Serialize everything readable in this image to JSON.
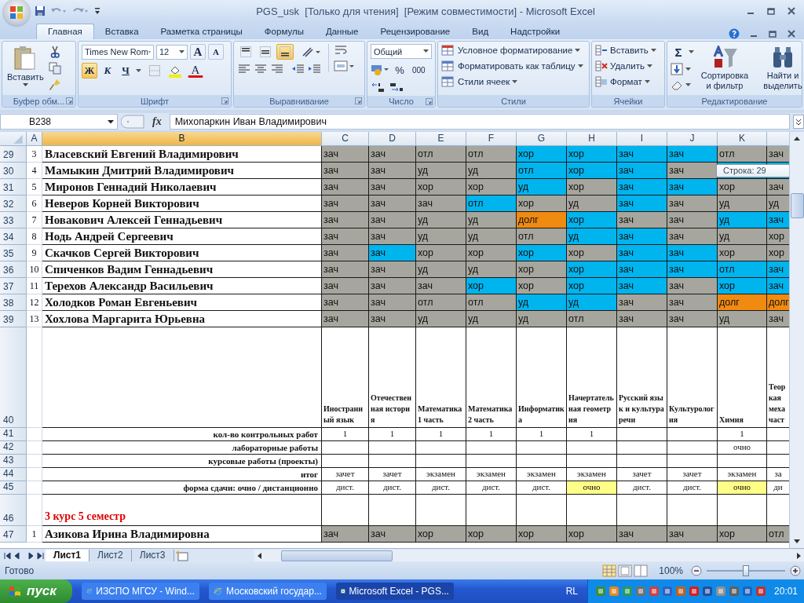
{
  "window": {
    "title": "PGS_usk  [Только для чтения]  [Режим совместимости] - Microsoft Excel"
  },
  "tabs": [
    {
      "label": "Главная",
      "selected": true
    },
    {
      "label": "Вставка",
      "selected": false
    },
    {
      "label": "Разметка страницы",
      "selected": false
    },
    {
      "label": "Формулы",
      "selected": false
    },
    {
      "label": "Данные",
      "selected": false
    },
    {
      "label": "Рецензирование",
      "selected": false
    },
    {
      "label": "Вид",
      "selected": false
    },
    {
      "label": "Надстройки",
      "selected": false
    }
  ],
  "clipboard": {
    "paste": "Вставить",
    "label": "Буфер обм..."
  },
  "font": {
    "name": "Times New Rom",
    "size": "12",
    "grow": "A",
    "shrink": "A",
    "bold": {
      "label": "Ж",
      "on": true
    },
    "italic": {
      "label": "К",
      "on": false
    },
    "underline": {
      "label": "Ч",
      "on": false
    },
    "color_letter": "A",
    "label": "Шрифт"
  },
  "alignment": {
    "vertical": [
      {
        "selected": false
      },
      {
        "selected": false
      },
      {
        "selected": true
      }
    ],
    "label": "Выравнивание"
  },
  "number": {
    "format": "Общий",
    "percent": "%",
    "thousands": "000",
    "label": "Число"
  },
  "styles": {
    "items": [
      "Условное форматирование",
      "Форматировать как таблицу",
      "Стили ячеек"
    ],
    "label": "Стили"
  },
  "cells": {
    "items": [
      "Вставить",
      "Удалить",
      "Формат"
    ],
    "label": "Ячейки"
  },
  "editing": {
    "sum": "Σ",
    "sort": "Сортировка и фильтр",
    "find": "Найти и выделить",
    "label": "Редактирование"
  },
  "formula_bar": {
    "name_box": "B238",
    "fx": "fx",
    "value": "Михопаркин Иван Владимирович"
  },
  "grid": {
    "columns": [
      {
        "label": "A",
        "selected": false
      },
      {
        "label": "B",
        "selected": true
      },
      {
        "label": "C",
        "selected": false
      },
      {
        "label": "D",
        "selected": false
      },
      {
        "label": "E",
        "selected": false
      },
      {
        "label": "F",
        "selected": false
      },
      {
        "label": "G",
        "selected": false
      },
      {
        "label": "H",
        "selected": false
      },
      {
        "label": "I",
        "selected": false
      },
      {
        "label": "J",
        "selected": false
      },
      {
        "label": "K",
        "selected": false
      }
    ],
    "rows": [
      {
        "kind": "student",
        "row": "29",
        "num": "3",
        "name": "Власевский Евгений Владимирович",
        "grades": [
          {
            "text": "зач",
            "color": "#a6a69e"
          },
          {
            "text": "зач",
            "color": "#a6a69e"
          },
          {
            "text": "отл",
            "color": "#a6a69e"
          },
          {
            "text": "отл",
            "color": "#a6a69e"
          },
          {
            "text": "хор",
            "color": "#00b4ee"
          },
          {
            "text": "хор",
            "color": "#00b4ee"
          },
          {
            "text": "зач",
            "color": "#00b4ee"
          },
          {
            "text": "зач",
            "color": "#00b4ee"
          },
          {
            "text": "отл",
            "color": "#a6a69e"
          },
          {
            "text": "зач",
            "color": "#a6a69e"
          }
        ]
      },
      {
        "kind": "student",
        "row": "30",
        "num": "4",
        "name": "Мамыкин Дмитрий Владимирович",
        "grades": [
          {
            "text": "зач",
            "color": "#a6a69e"
          },
          {
            "text": "зач",
            "color": "#a6a69e"
          },
          {
            "text": "уд",
            "color": "#a6a69e"
          },
          {
            "text": "уд",
            "color": "#a6a69e"
          },
          {
            "text": "отл",
            "color": "#00b4ee"
          },
          {
            "text": "хор",
            "color": "#00b4ee"
          },
          {
            "text": "зач",
            "color": "#00b4ee"
          },
          {
            "text": "зач",
            "color": "#a6a69e"
          },
          {
            "color": "#00b4ee"
          },
          {
            "color": "#00b4ee"
          }
        ]
      },
      {
        "kind": "student",
        "row": "31",
        "num": "5",
        "name": "Миронов Геннадий Николаевич",
        "grades": [
          {
            "text": "зач",
            "color": "#a6a69e"
          },
          {
            "text": "зач",
            "color": "#a6a69e"
          },
          {
            "text": "хор",
            "color": "#a6a69e"
          },
          {
            "text": "хор",
            "color": "#a6a69e"
          },
          {
            "text": "уд",
            "color": "#00b4ee"
          },
          {
            "text": "хор",
            "color": "#a6a69e"
          },
          {
            "text": "зач",
            "color": "#00b4ee"
          },
          {
            "text": "зач",
            "color": "#00b4ee"
          },
          {
            "text": "хор",
            "color": "#a6a69e"
          },
          {
            "text": "зач",
            "color": "#a6a69e"
          }
        ]
      },
      {
        "kind": "student",
        "row": "32",
        "num": "6",
        "name": "Неверов Корней Викторович",
        "grades": [
          {
            "text": "зач",
            "color": "#a6a69e"
          },
          {
            "text": "зач",
            "color": "#a6a69e"
          },
          {
            "text": "зач",
            "color": "#a6a69e"
          },
          {
            "text": "отл",
            "color": "#00b4ee"
          },
          {
            "text": "хор",
            "color": "#a6a69e"
          },
          {
            "text": "уд",
            "color": "#a6a69e"
          },
          {
            "text": "зач",
            "color": "#00b4ee"
          },
          {
            "text": "зач",
            "color": "#a6a69e"
          },
          {
            "text": "уд",
            "color": "#a6a69e"
          },
          {
            "text": "уд",
            "color": "#a6a69e"
          }
        ]
      },
      {
        "kind": "student",
        "row": "33",
        "num": "7",
        "name": "Новакович Алексей Геннадьевич",
        "grades": [
          {
            "text": "зач",
            "color": "#a6a69e"
          },
          {
            "text": "зач",
            "color": "#a6a69e"
          },
          {
            "text": "уд",
            "color": "#a6a69e"
          },
          {
            "text": "уд",
            "color": "#a6a69e"
          },
          {
            "text": "долг",
            "color": "#f08a10"
          },
          {
            "text": "хор",
            "color": "#00b4ee"
          },
          {
            "text": "зач",
            "color": "#a6a69e"
          },
          {
            "text": "зач",
            "color": "#a6a69e"
          },
          {
            "text": "уд",
            "color": "#00b4ee"
          },
          {
            "text": "зач",
            "color": "#00b4ee"
          }
        ]
      },
      {
        "kind": "student",
        "row": "34",
        "num": "8",
        "name": "Нодь Андрей Сергеевич",
        "grades": [
          {
            "text": "зач",
            "color": "#a6a69e"
          },
          {
            "text": "зач",
            "color": "#a6a69e"
          },
          {
            "text": "уд",
            "color": "#a6a69e"
          },
          {
            "text": "уд",
            "color": "#a6a69e"
          },
          {
            "text": "отл",
            "color": "#a6a69e"
          },
          {
            "text": "уд",
            "color": "#00b4ee"
          },
          {
            "text": "зач",
            "color": "#00b4ee"
          },
          {
            "text": "зач",
            "color": "#a6a69e"
          },
          {
            "text": "уд",
            "color": "#a6a69e"
          },
          {
            "text": "хор",
            "color": "#a6a69e"
          }
        ]
      },
      {
        "kind": "student",
        "row": "35",
        "num": "9",
        "name": "Скачков Сергей Викторович",
        "grades": [
          {
            "text": "зач",
            "color": "#a6a69e"
          },
          {
            "text": "зач",
            "color": "#00b4ee"
          },
          {
            "text": "хор",
            "color": "#a6a69e"
          },
          {
            "text": "хор",
            "color": "#a6a69e"
          },
          {
            "text": "хор",
            "color": "#00b4ee"
          },
          {
            "text": "хор",
            "color": "#a6a69e"
          },
          {
            "text": "зач",
            "color": "#00b4ee"
          },
          {
            "text": "зач",
            "color": "#00b4ee"
          },
          {
            "text": "хор",
            "color": "#a6a69e"
          },
          {
            "text": "хор",
            "color": "#a6a69e"
          }
        ]
      },
      {
        "kind": "student",
        "row": "36",
        "num": "10",
        "name": "Спиченков Вадим Геннадьевич",
        "grades": [
          {
            "text": "зач",
            "color": "#a6a69e"
          },
          {
            "text": "зач",
            "color": "#a6a69e"
          },
          {
            "text": "уд",
            "color": "#a6a69e"
          },
          {
            "text": "уд",
            "color": "#a6a69e"
          },
          {
            "text": "хор",
            "color": "#a6a69e"
          },
          {
            "text": "хор",
            "color": "#00b4ee"
          },
          {
            "text": "зач",
            "color": "#00b4ee"
          },
          {
            "text": "зач",
            "color": "#00b4ee"
          },
          {
            "text": "отл",
            "color": "#00b4ee"
          },
          {
            "text": "зач",
            "color": "#00b4ee"
          }
        ]
      },
      {
        "kind": "student",
        "row": "37",
        "num": "11",
        "name": "Терехов Александр Васильевич",
        "grades": [
          {
            "text": "зач",
            "color": "#a6a69e"
          },
          {
            "text": "зач",
            "color": "#a6a69e"
          },
          {
            "text": "зач",
            "color": "#a6a69e"
          },
          {
            "text": "хор",
            "color": "#00b4ee"
          },
          {
            "text": "хор",
            "color": "#a6a69e"
          },
          {
            "text": "хор",
            "color": "#00b4ee"
          },
          {
            "text": "зач",
            "color": "#00b4ee"
          },
          {
            "text": "зач",
            "color": "#a6a69e"
          },
          {
            "text": "хор",
            "color": "#00b4ee"
          },
          {
            "text": "зач",
            "color": "#00b4ee"
          }
        ]
      },
      {
        "kind": "student",
        "row": "38",
        "num": "12",
        "name": "Холодков Роман Евгеньевич",
        "grades": [
          {
            "text": "зач",
            "color": "#a6a69e"
          },
          {
            "text": "зач",
            "color": "#a6a69e"
          },
          {
            "text": "отл",
            "color": "#a6a69e"
          },
          {
            "text": "отл",
            "color": "#a6a69e"
          },
          {
            "text": "уд",
            "color": "#00b4ee"
          },
          {
            "text": "уд",
            "color": "#00b4ee"
          },
          {
            "text": "зач",
            "color": "#a6a69e"
          },
          {
            "text": "зач",
            "color": "#a6a69e"
          },
          {
            "text": "долг",
            "color": "#f08a10"
          },
          {
            "text": "долг",
            "color": "#f08a10"
          }
        ]
      },
      {
        "kind": "student",
        "row": "39",
        "num": "13",
        "name": "Хохлова Маргарита Юрьевна",
        "grades": [
          {
            "text": "зач",
            "color": "#a6a69e"
          },
          {
            "text": "зач",
            "color": "#a6a69e"
          },
          {
            "text": "уд",
            "color": "#a6a69e"
          },
          {
            "text": "уд",
            "color": "#a6a69e"
          },
          {
            "text": "уд",
            "color": "#a6a69e"
          },
          {
            "text": "отл",
            "color": "#a6a69e"
          },
          {
            "text": "зач",
            "color": "#a6a69e"
          },
          {
            "text": "зач",
            "color": "#a6a69e"
          },
          {
            "text": "уд",
            "color": "#a6a69e"
          },
          {
            "text": "зач",
            "color": "#a6a69e"
          }
        ]
      },
      {
        "kind": "subjects",
        "row": "40"
      },
      {
        "kind": "summary",
        "row": "41",
        "label": "кол-во контрольных работ"
      },
      {
        "kind": "summary",
        "row": "42",
        "label": "лабораторные работы"
      },
      {
        "kind": "summary",
        "row": "43",
        "label": "курсовые работы (проекты)"
      },
      {
        "kind": "summary",
        "row": "44",
        "label": "итог"
      },
      {
        "kind": "summary",
        "row": "45",
        "label": "форма сдачи: очно / дистанционно"
      },
      {
        "kind": "section",
        "row": "46",
        "title": "3 курс 5 семестр"
      },
      {
        "kind": "student",
        "row": "47",
        "num": "1",
        "name": "Азикова Ирина Владимировна",
        "grades": [
          {
            "text": "зач",
            "color": "#a6a69e"
          },
          {
            "text": "зач",
            "color": "#a6a69e"
          },
          {
            "text": "хор",
            "color": "#a6a69e"
          },
          {
            "text": "хор",
            "color": "#a6a69e"
          },
          {
            "text": "хор",
            "color": "#a6a69e"
          },
          {
            "text": "хор",
            "color": "#a6a69e"
          },
          {
            "text": "зач",
            "color": "#a6a69e"
          },
          {
            "text": "зач",
            "color": "#a6a69e"
          },
          {
            "text": "хор",
            "color": "#a6a69e"
          },
          {
            "text": "отл",
            "color": "#a6a69e"
          }
        ]
      }
    ],
    "subjects": [
      {
        "title": "Иностранный язык",
        "control_works": "1",
        "result": "зачет",
        "form": {
          "text": "дист."
        }
      },
      {
        "title": "Отечественная история",
        "control_works": "1",
        "result": "зачет",
        "form": {
          "text": "дист."
        }
      },
      {
        "title": "Математика 1 часть",
        "control_works": "1",
        "result": "экзамен",
        "form": {
          "text": "дист."
        }
      },
      {
        "title": "Математика 2 часть",
        "control_works": "1",
        "result": "экзамен",
        "form": {
          "text": "дист."
        }
      },
      {
        "title": "Информатика",
        "control_works": "1",
        "result": "экзамен",
        "form": {
          "text": "дист."
        }
      },
      {
        "title": "Начертательная геометрия",
        "control_works": "1",
        "result": "экзамен",
        "form": {
          "text": "очно",
          "color": "#ffff88"
        }
      },
      {
        "title": "Русский язык и культура речи",
        "result": "зачет",
        "form": {
          "text": "дист."
        }
      },
      {
        "title": "Культурология",
        "result": "зачет",
        "form": {
          "text": "дист."
        }
      },
      {
        "title": "Химия",
        "control_works": "1",
        "labs": "очно",
        "result": "экзамен",
        "form": {
          "text": "очно",
          "color": "#ffff88"
        }
      },
      {
        "title": "Теор кая меха част",
        "result": "за",
        "form": {
          "text": "ди"
        }
      }
    ]
  },
  "tooltip": "Строка: 29",
  "sheets": [
    {
      "label": "Лист1",
      "selected": true
    },
    {
      "label": "Лист2",
      "selected": false
    },
    {
      "label": "Лист3",
      "selected": false
    }
  ],
  "status_bar": {
    "text": "Готово",
    "zoom": {
      "reading": "100%",
      "level": 0.5
    }
  },
  "taskbar": {
    "start": "пуск",
    "tasks": [
      {
        "kind": "browser",
        "label": "ИЗСПО МГСУ - Wind...",
        "selected": false
      },
      {
        "kind": "browser",
        "label": "Московский государ...",
        "selected": false
      },
      {
        "kind": "excel",
        "label": "Microsoft Excel - PGS...",
        "selected": true
      }
    ],
    "language": "RL",
    "clock": "20:01"
  }
}
